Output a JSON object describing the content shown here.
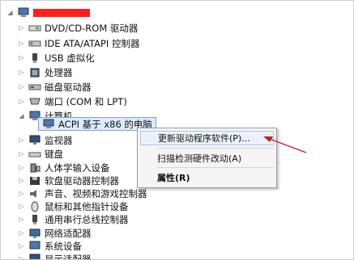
{
  "colors": {
    "redaction": "#ff1f1f",
    "arrow": "#c81e1e",
    "selection": "#dcecfc",
    "menu_highlight": "#eaf3fd"
  },
  "tree": {
    "root": {
      "icon": "computer-icon",
      "label": ""
    },
    "items": [
      {
        "label": "DVD/CD-ROM 驱动器",
        "icon": "dvd-drive-icon"
      },
      {
        "label": "IDE ATA/ATAPI 控制器",
        "icon": "ide-controller-icon"
      },
      {
        "label": "USB 虚拟化",
        "icon": "usb-icon"
      },
      {
        "label": "处理器",
        "icon": "processor-icon"
      },
      {
        "label": "磁盘驱动器",
        "icon": "disk-drive-icon"
      },
      {
        "label": "端口 (COM 和 LPT)",
        "icon": "port-icon"
      },
      {
        "label": "计算机",
        "icon": "computer-icon"
      },
      {
        "label": "ACPI 基于 x86 的电脑",
        "icon": "pc-icon"
      },
      {
        "label": "监视器",
        "icon": "monitor-icon"
      },
      {
        "label": "键盘",
        "icon": "keyboard-icon"
      },
      {
        "label": "人体学输入设备",
        "icon": "hid-icon"
      },
      {
        "label": "软盘驱动器控制器",
        "icon": "floppy-controller-icon"
      },
      {
        "label": "声音、视频和游戏控制器",
        "icon": "sound-icon"
      },
      {
        "label": "鼠标和其他指针设备",
        "icon": "mouse-icon"
      },
      {
        "label": "通用串行总线控制器",
        "icon": "usb-controller-icon"
      },
      {
        "label": "网络适配器",
        "icon": "network-icon"
      },
      {
        "label": "系统设备",
        "icon": "system-device-icon"
      },
      {
        "label": "显示适配器",
        "icon": "display-adapter-icon"
      }
    ]
  },
  "context_menu": {
    "update_driver": "更新驱动程序软件(P)...",
    "scan_hardware": "扫描检测硬件改动(A)",
    "properties": "属性(R)"
  }
}
